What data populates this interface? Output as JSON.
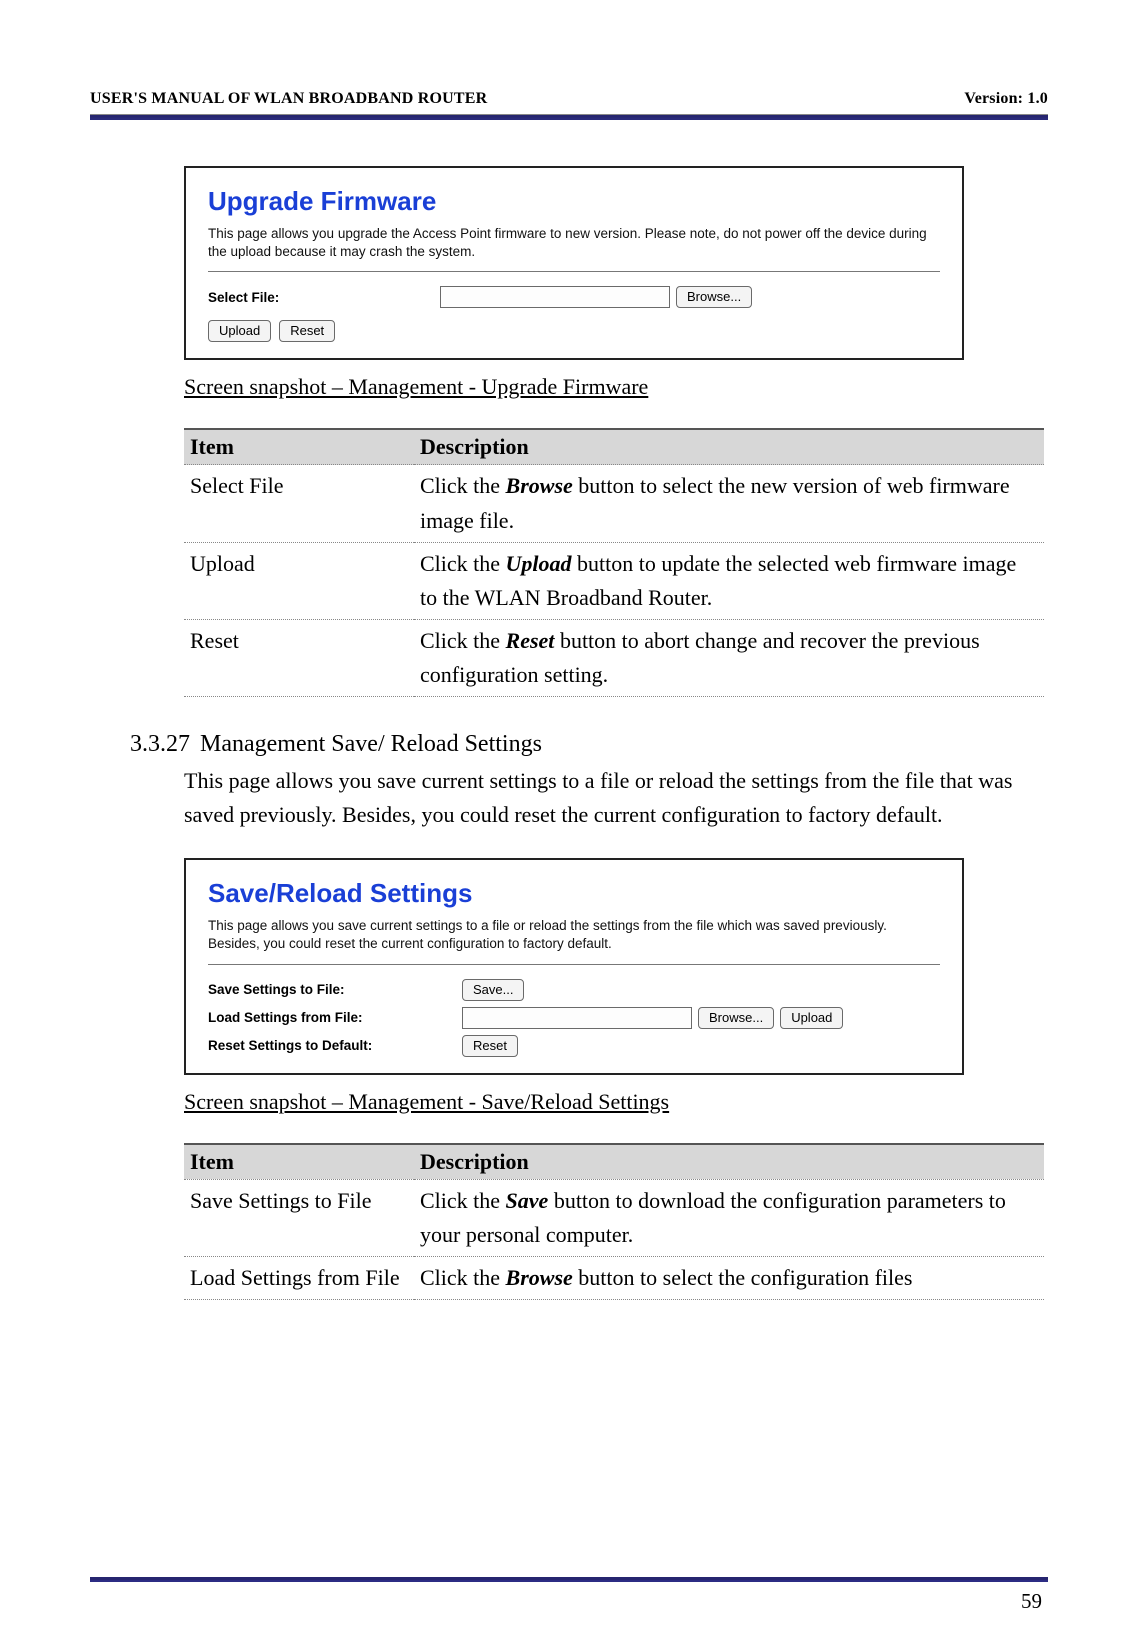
{
  "header": {
    "title": "USER'S MANUAL OF WLAN BROADBAND ROUTER",
    "version": "Version: 1.0"
  },
  "panel1": {
    "title": "Upgrade Firmware",
    "desc": "This page allows you upgrade the Access Point firmware to new version. Please note, do not power off the device during the upload because it may crash the system.",
    "selectFileLabel": "Select File:",
    "browse": "Browse...",
    "upload": "Upload",
    "reset": "Reset"
  },
  "caption1": "Screen snapshot – Management - Upgrade Firmware",
  "table1": {
    "head_item": "Item",
    "head_desc": "Description",
    "row1_item": "Select File",
    "row1_desc_a": "Click the ",
    "row1_desc_b": "Browse",
    "row1_desc_c": " button to select the new version of web firmware image file.",
    "row2_item": "Upload",
    "row2_desc_a": "Click the ",
    "row2_desc_b": "Upload",
    "row2_desc_c": " button to update the selected web firmware image to the WLAN Broadband Router.",
    "row3_item": "Reset",
    "row3_desc_a": "Click the ",
    "row3_desc_b": "Reset",
    "row3_desc_c": " button to abort change and recover the previous configuration setting."
  },
  "section": {
    "num": "3.3.27",
    "title": "Management Save/ Reload Settings",
    "body": "This page allows you save current settings to a file or reload the settings from the file that was saved previously. Besides, you could reset the current configuration to factory default."
  },
  "panel2": {
    "title": "Save/Reload Settings",
    "desc": "This page allows you save current settings to a file or reload the settings from the file which was saved previously. Besides, you could reset the current configuration to factory default.",
    "saveLabel": "Save Settings to File:",
    "loadLabel": "Load Settings from File:",
    "resetLabel": "Reset Settings to Default:",
    "save": "Save...",
    "browse": "Browse...",
    "upload": "Upload",
    "reset": "Reset"
  },
  "caption2": "Screen snapshot – Management - Save/Reload Settings",
  "table2": {
    "head_item": "Item",
    "head_desc": "Description",
    "row1_item": "Save Settings to File",
    "row1_desc_a": "Click the ",
    "row1_desc_b": "Save",
    "row1_desc_c": " button to download the configuration parameters to your personal computer.",
    "row2_item": "Load Settings from File",
    "row2_desc_a": "Click the ",
    "row2_desc_b": "Browse",
    "row2_desc_c": " button to select the configuration files"
  },
  "pageNumber": "59"
}
